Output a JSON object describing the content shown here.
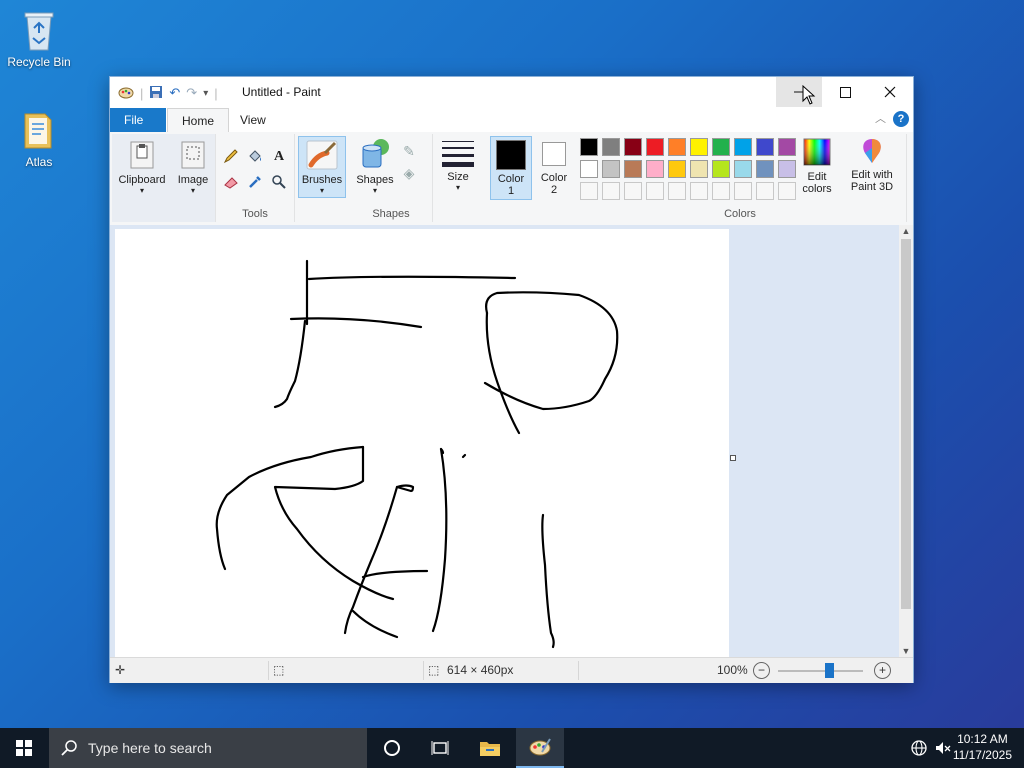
{
  "desktop": {
    "icons": [
      {
        "label": "Recycle Bin"
      },
      {
        "label": "Atlas"
      }
    ]
  },
  "window": {
    "title": "Untitled - Paint",
    "tabs": {
      "file": "File",
      "home": "Home",
      "view": "View"
    },
    "help": "?"
  },
  "ribbon": {
    "clipboard": "Clipboard",
    "image": "Image",
    "tools_group": "Tools",
    "brushes": "Brushes",
    "shapes_btn": "Shapes",
    "shapes_group": "Shapes",
    "size": "Size",
    "color1_line1": "Color",
    "color1_line2": "1",
    "color2_line1": "Color",
    "color2_line2": "2",
    "colors_group": "Colors",
    "edit_colors_line1": "Edit",
    "edit_colors_line2": "colors",
    "paint3d_line1": "Edit with",
    "paint3d_line2": "Paint 3D",
    "palette_row1": [
      "#000000",
      "#7f7f7f",
      "#880015",
      "#ed1c24",
      "#ff7f27",
      "#fff200",
      "#22b14c",
      "#00a2e8",
      "#3f48cc",
      "#a349a4"
    ],
    "palette_row2": [
      "#ffffff",
      "#c3c3c3",
      "#b97a57",
      "#ffaec9",
      "#ffc90e",
      "#efe4b0",
      "#b5e61d",
      "#99d9ea",
      "#7092be",
      "#c8bfe7"
    ],
    "color1": "#000000",
    "color2": "#ffffff"
  },
  "status": {
    "canvas_size": "614 × 460px",
    "zoom": "100%",
    "zoom_level": 1.0
  },
  "taskbar": {
    "search_placeholder": "Type here to search",
    "time": "10:12 AM",
    "date": "11/17/2025"
  }
}
